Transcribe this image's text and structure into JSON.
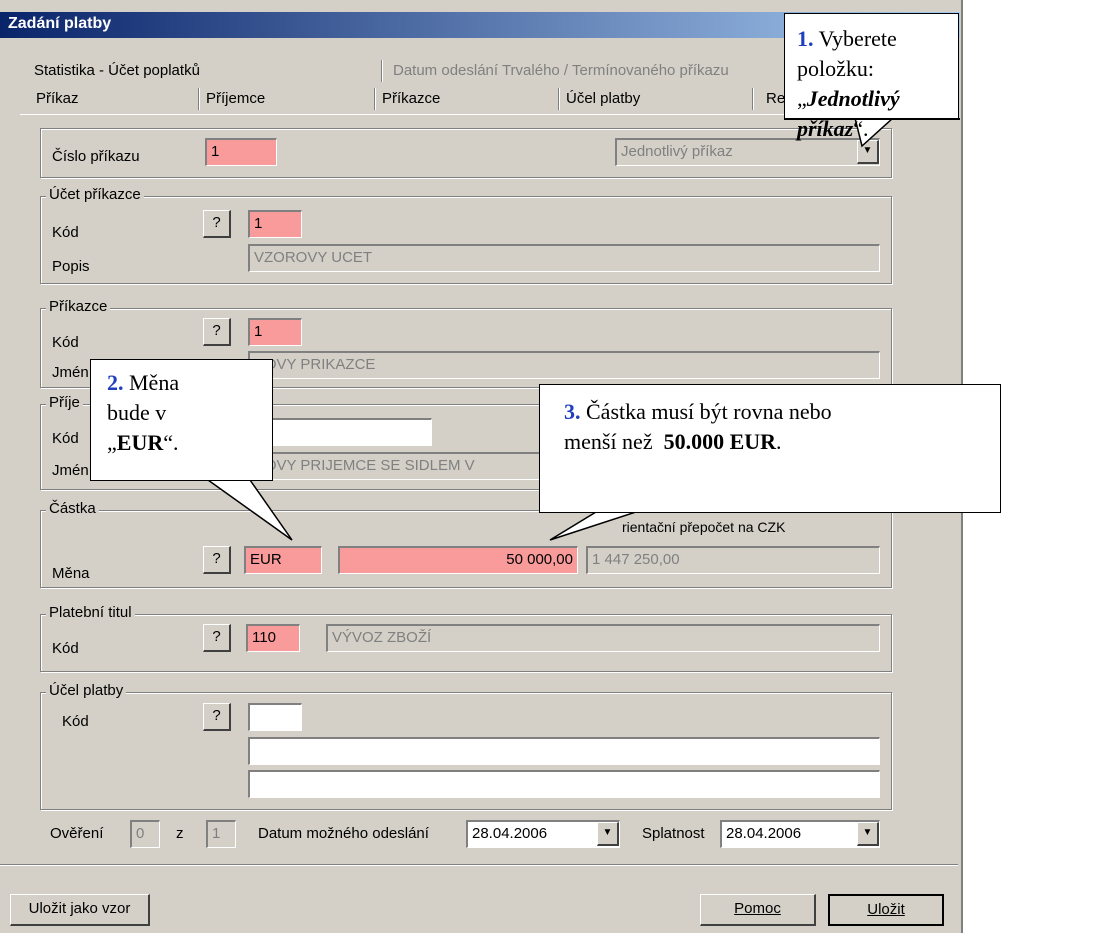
{
  "window": {
    "title": "Zadání platby"
  },
  "tabs_back": [
    "Statistika - Účet poplatků",
    "Datum odeslání Trvalého / Termínovaného příkazu"
  ],
  "tabs_front": [
    "Příkaz",
    "Příjemce",
    "Příkazce",
    "Účel platby",
    "Re"
  ],
  "prikaz": {
    "label": "Číslo příkazu",
    "value": "1",
    "type_value": "Jednotlivý příkaz"
  },
  "ucet_prikazce": {
    "title": "Účet příkazce",
    "kod_label": "Kód",
    "kod_value": "1",
    "popis_label": "Popis",
    "popis_value": "VZOROVY UCET"
  },
  "prikazce": {
    "title": "Příkazce",
    "kod_label": "Kód",
    "kod_value": "1",
    "jmeno_label": "Jmén",
    "jmeno_value": "ROVY PRIKAZCE"
  },
  "prijemce": {
    "title": "Příje",
    "kod_label": "Kód",
    "kod_value": "",
    "jmeno_label": "Jmén",
    "jmeno_value": "ROVY PRIJEMCE SE SIDLEM V"
  },
  "castka": {
    "title": "Částka",
    "mena_label": "Měna",
    "mena_value": "EUR",
    "amount_value": "50 000,00",
    "prepocet_label": "rientační přepočet na CZK",
    "prepocet_value": "1 447 250,00"
  },
  "platebni_titul": {
    "title": "Platební titul",
    "kod_label": "Kód",
    "kod_value": "110",
    "popis_value": "VÝVOZ ZBOŽÍ"
  },
  "ucel_platby": {
    "title": "Účel platby",
    "kod_label": "Kód",
    "kod_value": ""
  },
  "bottom": {
    "overeni_label": "Ověření",
    "overeni_value": "0",
    "z_label": "z",
    "z_value": "1",
    "datum_label": "Datum možného odeslání",
    "datum_value": "28.04.2006",
    "splatnost_label": "Splatnost",
    "splatnost_value": "28.04.2006"
  },
  "buttons": {
    "q": "?",
    "ulozit_vzor": "Uložit jako vzor",
    "pomoc": "Pomoc",
    "ulozit": "Uložit"
  },
  "callouts": {
    "c1": {
      "num": "1.",
      "text1": "Vyberete položku:",
      "quote_open": "„",
      "bold": "Jednotlivý příkaz",
      "quote_close": "“."
    },
    "c2": {
      "num": "2.",
      "text1": "Měna",
      "text2": "bude v",
      "quote_open": "„",
      "bold": "EUR",
      "quote_close": "“."
    },
    "c3": {
      "num": "3.",
      "text1": "Částka musí být rovna nebo",
      "text2": "menší než",
      "bold": "50.000 EUR",
      "tail": "."
    }
  },
  "icons": {
    "dropdown": "▼"
  }
}
